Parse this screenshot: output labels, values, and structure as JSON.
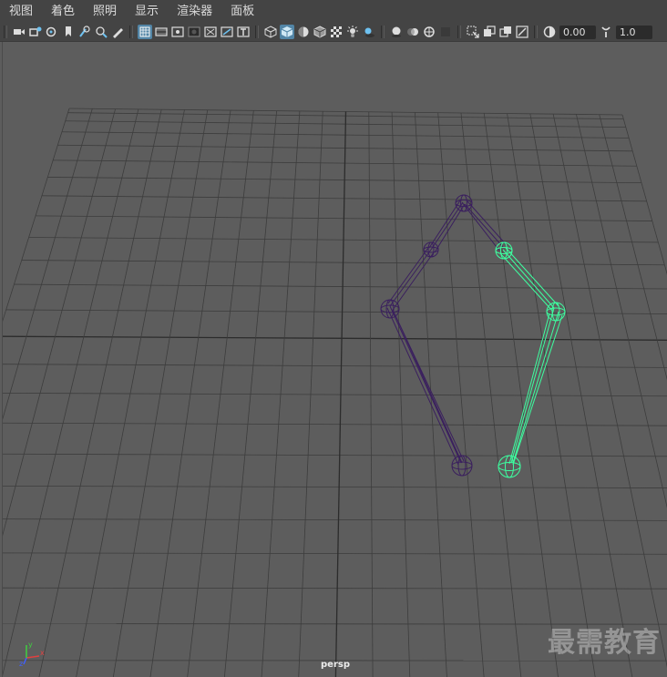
{
  "menu": [
    {
      "label": "视图",
      "name": "menu-view"
    },
    {
      "label": "着色",
      "name": "menu-shading"
    },
    {
      "label": "照明",
      "name": "menu-lighting"
    },
    {
      "label": "显示",
      "name": "menu-show"
    },
    {
      "label": "渲染器",
      "name": "menu-renderer"
    },
    {
      "label": "面板",
      "name": "menu-panels"
    }
  ],
  "toolbar": {
    "exposure_value": "0.00",
    "gamma_value": "1.0"
  },
  "viewport": {
    "camera_label": "persp",
    "watermark": "最需教育"
  },
  "axes": {
    "x": "x",
    "y": "y",
    "z": "z"
  },
  "colors": {
    "background": "#5d5d5d",
    "grid": "#3d3d3d",
    "grid_axis": "#2c2c2c",
    "skeleton_unselected": "#3a1f5e",
    "skeleton_selected": "#3dffa0",
    "axis_x": "#e04040",
    "axis_y": "#40d040",
    "axis_z": "#4060ff"
  }
}
